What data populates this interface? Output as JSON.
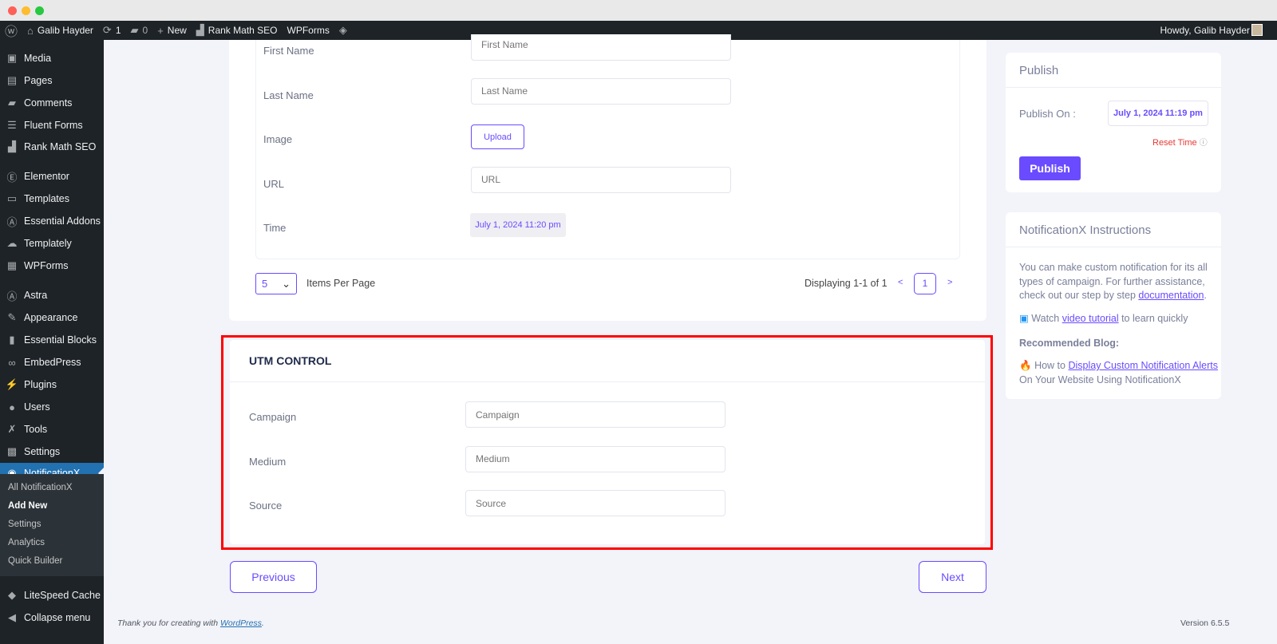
{
  "window": {
    "controls": [
      "close",
      "minimize",
      "maximize"
    ]
  },
  "adminbar": {
    "site": "Galib Hayder",
    "updates": "1",
    "comments": "0",
    "new": "New",
    "rankmath": "Rank Math SEO",
    "wpforms": "WPForms",
    "howdy": "Howdy, Galib Hayder"
  },
  "sidebar": {
    "items": [
      {
        "label": "Media",
        "icon": "media-icon"
      },
      {
        "label": "Pages",
        "icon": "pages-icon"
      },
      {
        "label": "Comments",
        "icon": "comments-icon"
      },
      {
        "label": "Fluent Forms",
        "icon": "forms-icon"
      },
      {
        "label": "Rank Math SEO",
        "icon": "rankmath-icon"
      },
      {
        "label": "Elementor",
        "icon": "elementor-icon"
      },
      {
        "label": "Templates",
        "icon": "folder-icon"
      },
      {
        "label": "Essential Addons",
        "icon": "ea-icon"
      },
      {
        "label": "Templately",
        "icon": "templately-icon"
      },
      {
        "label": "WPForms",
        "icon": "wpforms-icon"
      },
      {
        "label": "Astra",
        "icon": "astra-icon"
      },
      {
        "label": "Appearance",
        "icon": "brush-icon"
      },
      {
        "label": "Essential Blocks",
        "icon": "blocks-icon"
      },
      {
        "label": "EmbedPress",
        "icon": "embed-icon"
      },
      {
        "label": "Plugins",
        "icon": "plugin-icon"
      },
      {
        "label": "Users",
        "icon": "user-icon"
      },
      {
        "label": "Tools",
        "icon": "wrench-icon"
      },
      {
        "label": "Settings",
        "icon": "settings-icon"
      },
      {
        "label": "NotificationX",
        "icon": "bell-icon",
        "active": true
      }
    ],
    "submenu": [
      "All NotificationX",
      "Add New",
      "Settings",
      "Analytics",
      "Quick Builder"
    ],
    "current_sub": "Add New",
    "litespeed": "LiteSpeed Cache",
    "collapse": "Collapse menu"
  },
  "form": {
    "fields": [
      {
        "label": "First Name",
        "placeholder": "First Name"
      },
      {
        "label": "Last Name",
        "placeholder": "Last Name"
      },
      {
        "label": "Image",
        "button": "Upload"
      },
      {
        "label": "URL",
        "placeholder": "URL"
      },
      {
        "label": "Time",
        "value": "July 1, 2024 11:20 pm"
      }
    ],
    "per_page": "5",
    "per_page_label": "Items Per Page",
    "displaying": "Displaying 1-1 of 1",
    "page": "1",
    "prev": "<",
    "next": ">"
  },
  "utm": {
    "title": "UTM CONTROL",
    "fields": [
      {
        "label": "Campaign",
        "placeholder": "Campaign"
      },
      {
        "label": "Medium",
        "placeholder": "Medium"
      },
      {
        "label": "Source",
        "placeholder": "Source"
      }
    ],
    "highlight_color": "#ff0000"
  },
  "nav": {
    "previous": "Previous",
    "next": "Next"
  },
  "publish": {
    "title": "Publish",
    "on_label": "Publish On :",
    "date": "July 1, 2024 11:19 pm",
    "reset": "Reset Time",
    "button": "Publish"
  },
  "instructions": {
    "title": "NotificationX Instructions",
    "p1": "You can make custom notification for its all types of campaign. For further assistance, check out our step by step ",
    "doc_link": "documentation",
    "watch": "Watch ",
    "video_link": "video tutorial",
    "watch_rest": " to learn quickly",
    "rec": "Recommended Blog:",
    "howto": "How to ",
    "blog_link": "Display Custom Notification Alerts",
    "blog_rest": "On Your Website Using NotificationX"
  },
  "footer": {
    "thanks": "Thank you for creating with ",
    "wp": "WordPress",
    "version": "Version 6.5.5"
  },
  "colors": {
    "accent": "#6a4bff",
    "wp_active": "#2271b1",
    "admin_bg": "#1d2327"
  }
}
